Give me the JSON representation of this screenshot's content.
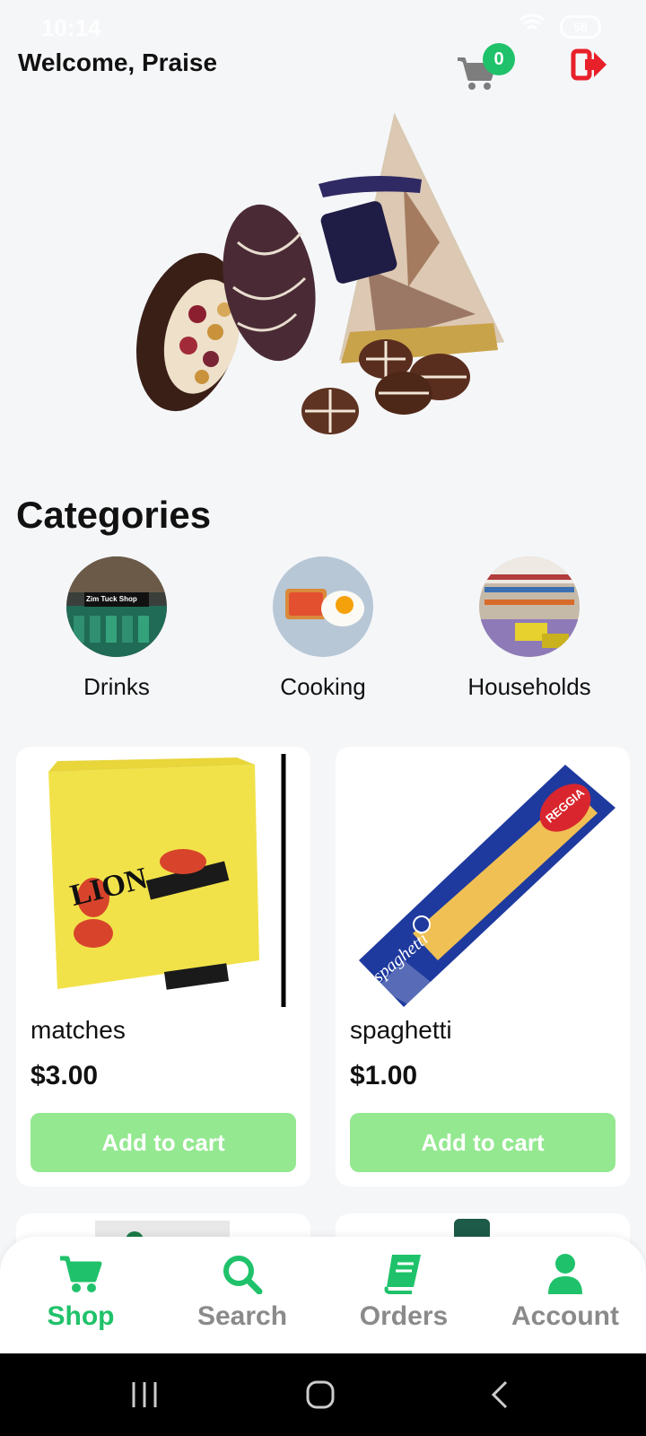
{
  "status": {
    "time": "10:14",
    "battery": "58"
  },
  "header": {
    "welcome": "Welcome, Praise",
    "cart_count": "0"
  },
  "categories": {
    "title": "Categories",
    "items": [
      {
        "label": "Drinks",
        "thumb_text": "Zim Tuck Shop"
      },
      {
        "label": "Cooking"
      },
      {
        "label": "Households"
      }
    ]
  },
  "products": [
    {
      "name": "matches",
      "price": "$3.00",
      "button": "Add to cart",
      "packaging_text": "LION"
    },
    {
      "name": "spaghetti",
      "price": "$1.00",
      "button": "Add to cart",
      "packaging_text": "REGGIA"
    }
  ],
  "bottom_nav": {
    "items": [
      {
        "label": "Shop",
        "icon": "cart-icon",
        "active": true
      },
      {
        "label": "Search",
        "icon": "search-icon",
        "active": false
      },
      {
        "label": "Orders",
        "icon": "book-icon",
        "active": false
      },
      {
        "label": "Account",
        "icon": "user-icon",
        "active": false
      }
    ]
  },
  "colors": {
    "accent": "#1fc26a",
    "button_bg": "#94e890",
    "inactive_nav": "#8a8a8a",
    "logout": "#e8202a"
  }
}
